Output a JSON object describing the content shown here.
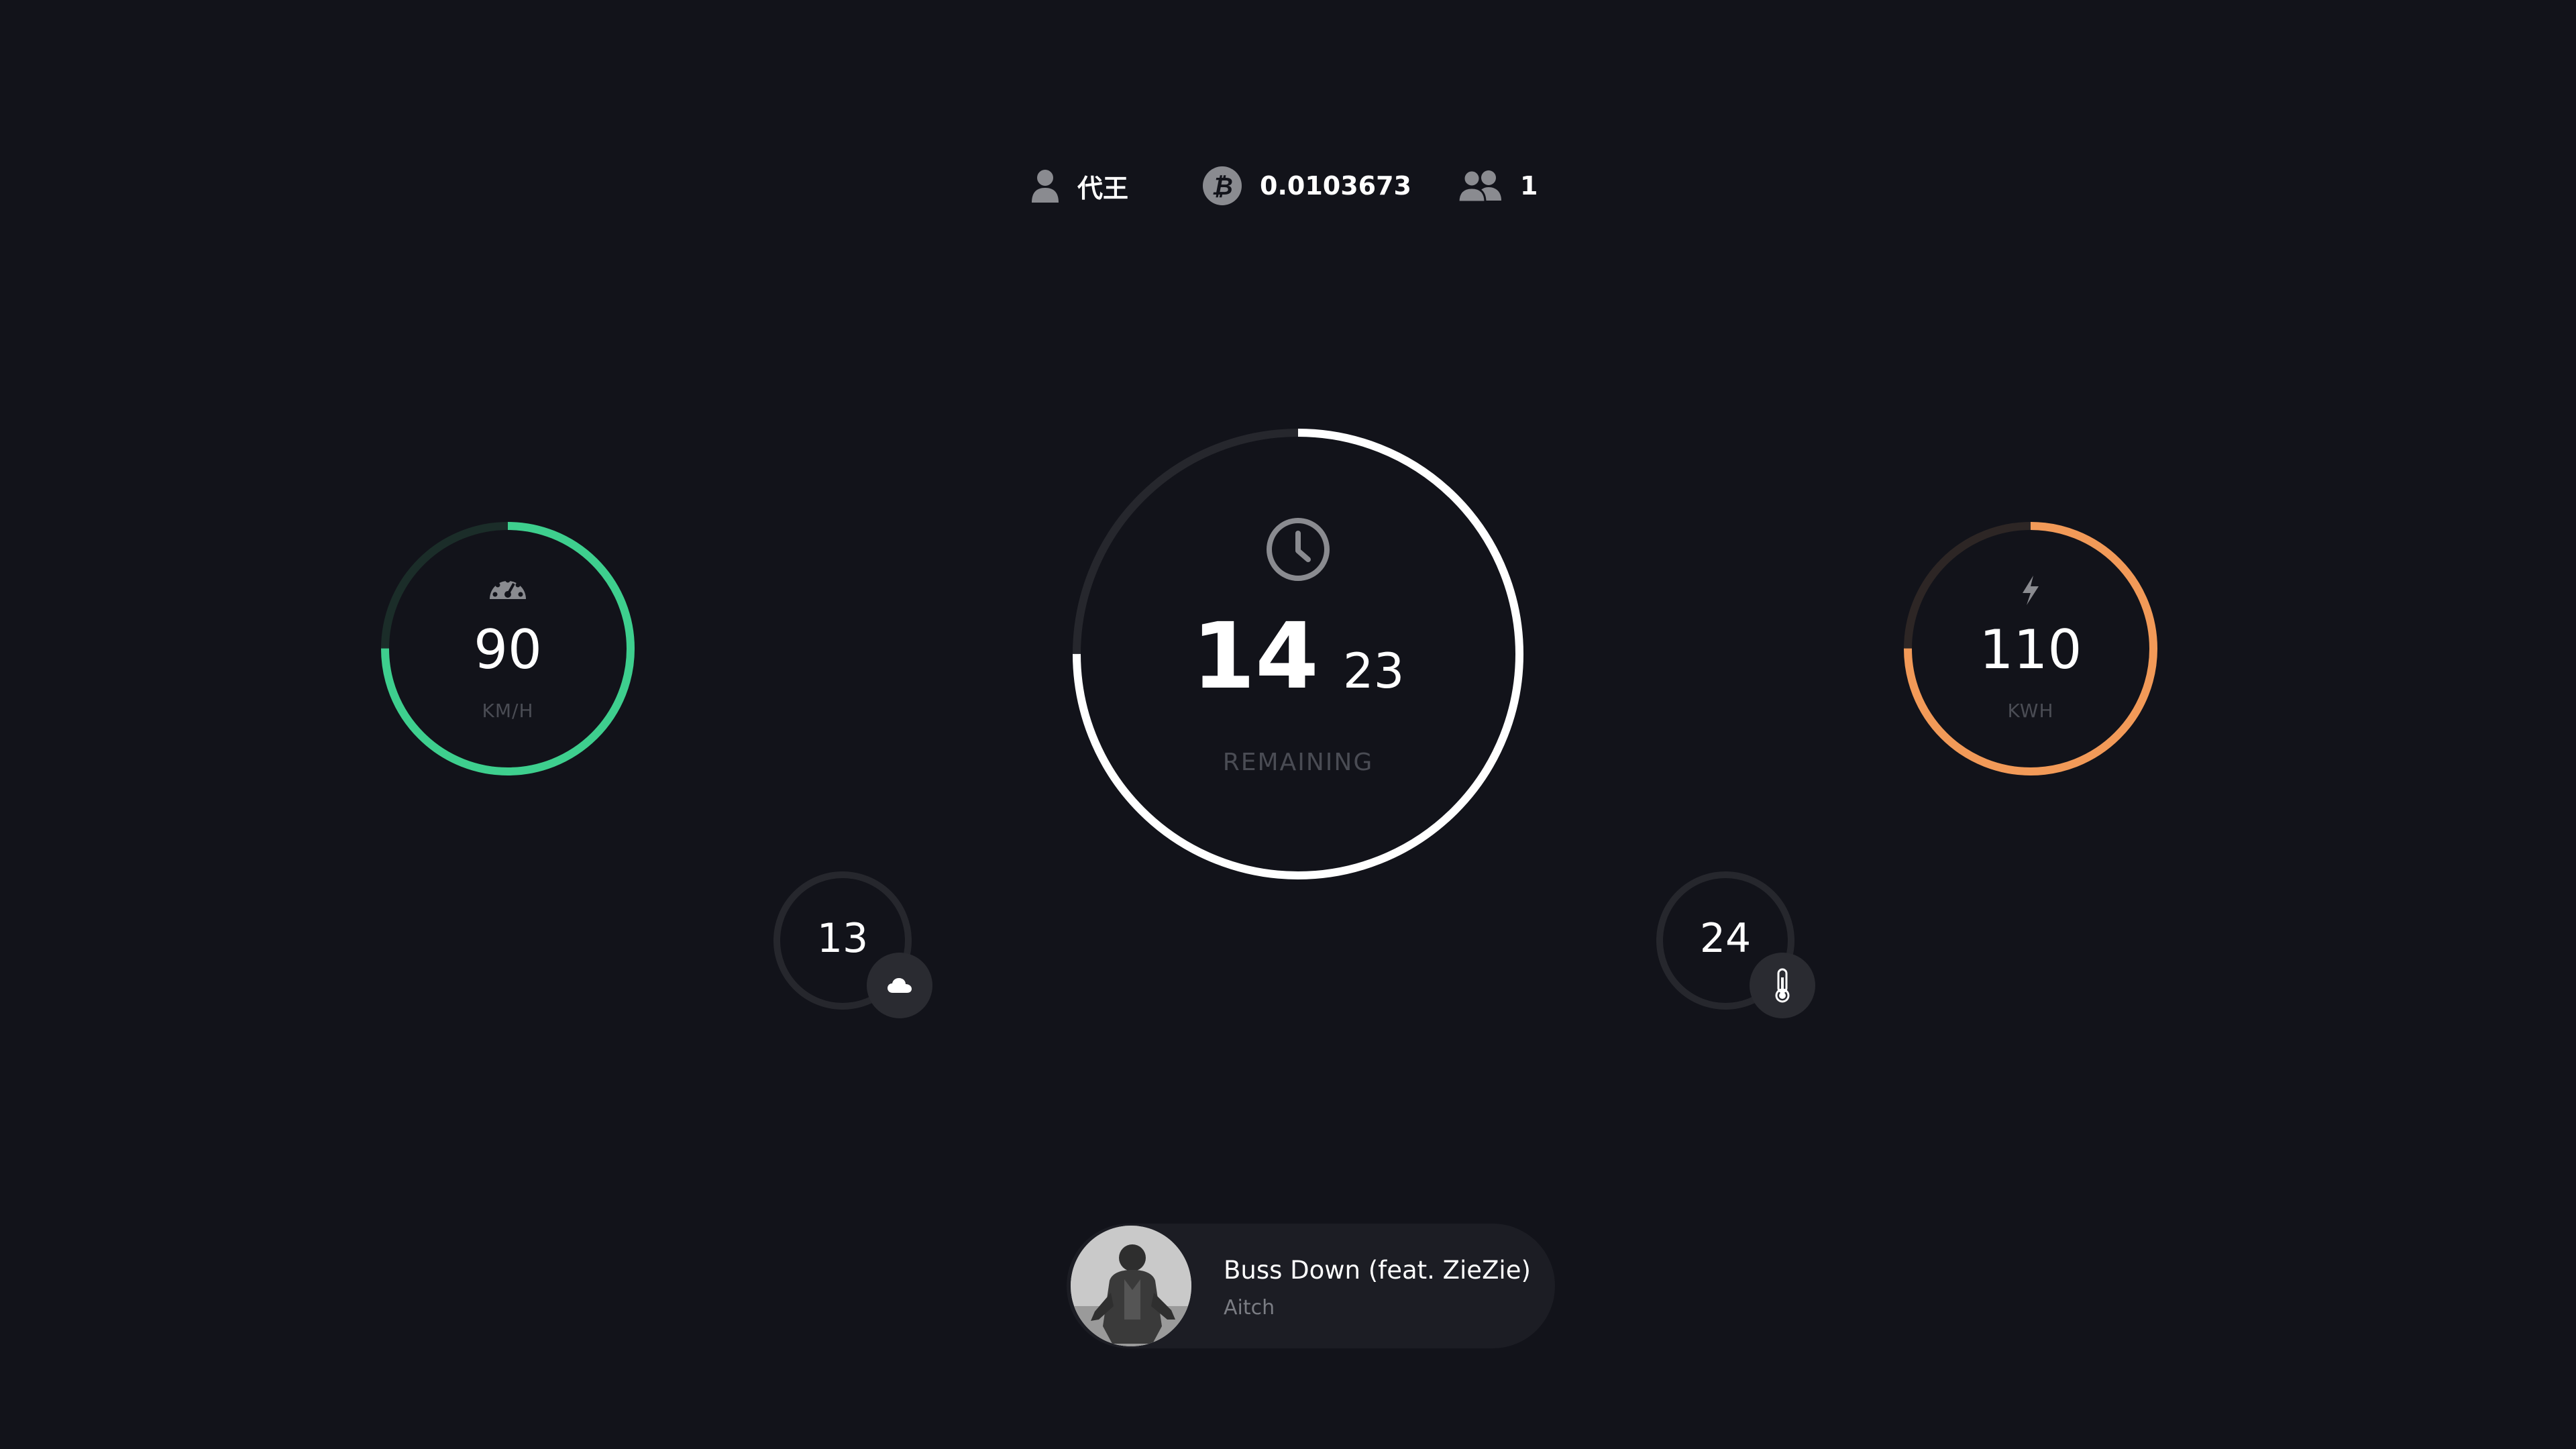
{
  "header": {
    "player_name": "代王",
    "bitcoin_balance": "0.0103673",
    "players_online": "1"
  },
  "speed": {
    "value": "90",
    "unit": "KM/H",
    "level": 0.75,
    "color": "#3ecf8e",
    "icon": "speedometer-icon"
  },
  "timer": {
    "hours": "14",
    "minutes": "23",
    "label": "REMAINING",
    "level": 0.75,
    "color": "#ffffff",
    "icon": "clock-icon"
  },
  "energy": {
    "value": "110",
    "unit": "KWH",
    "level": 0.75,
    "color": "#f29a58",
    "icon": "lightning-icon"
  },
  "weather": {
    "value": "13",
    "icon": "cloud-icon"
  },
  "temperature": {
    "value": "24",
    "icon": "thermometer-icon"
  },
  "music": {
    "song": "Buss Down (feat. ZieZie)",
    "artist": "Aitch",
    "cover": "album-cover"
  },
  "colors": {
    "background": "#12131a",
    "track": "#26272d",
    "text_muted": "#4a4c54",
    "icon_gray": "#8a8b90"
  }
}
